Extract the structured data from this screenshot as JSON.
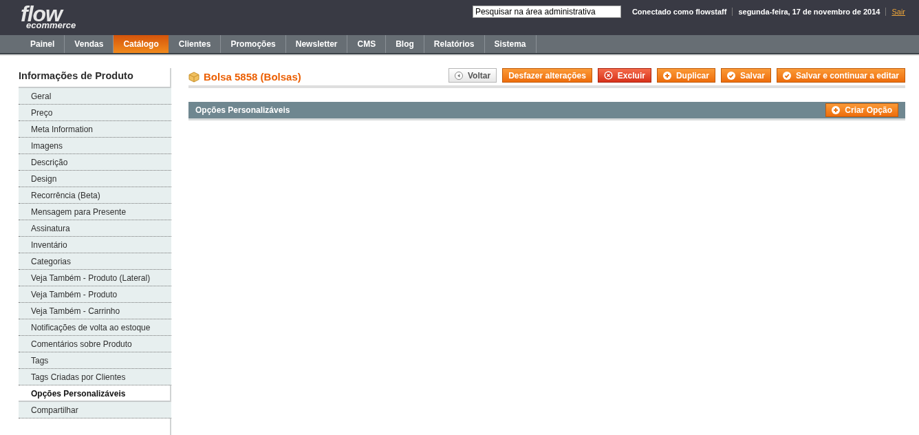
{
  "logo": {
    "title": "flow",
    "subtitle": "ecommerce"
  },
  "header": {
    "search": {
      "placeholder": "Pesquisar na área administrativa"
    },
    "user": "Conectado como flowstaff",
    "date": "segunda-feira, 17 de novembro de 2014",
    "logout": "Sair"
  },
  "nav": [
    {
      "label": "Painel",
      "selected": false
    },
    {
      "label": "Vendas",
      "selected": false
    },
    {
      "label": "Catálogo",
      "selected": true
    },
    {
      "label": "Clientes",
      "selected": false
    },
    {
      "label": "Promoções",
      "selected": false
    },
    {
      "label": "Newsletter",
      "selected": false
    },
    {
      "label": "CMS",
      "selected": false
    },
    {
      "label": "Blog",
      "selected": false
    },
    {
      "label": "Relatórios",
      "selected": false
    },
    {
      "label": "Sistema",
      "selected": false
    }
  ],
  "sidebar": {
    "title": "Informações de Produto",
    "items": [
      {
        "label": "Geral",
        "selected": false
      },
      {
        "label": "Preço",
        "selected": false
      },
      {
        "label": "Meta Information",
        "selected": false
      },
      {
        "label": "Imagens",
        "selected": false
      },
      {
        "label": "Descrição",
        "selected": false
      },
      {
        "label": "Design",
        "selected": false
      },
      {
        "label": "Recorrência (Beta)",
        "selected": false
      },
      {
        "label": "Mensagem para Presente",
        "selected": false
      },
      {
        "label": "Assinatura",
        "selected": false
      },
      {
        "label": "Inventário",
        "selected": false
      },
      {
        "label": "Categorias",
        "selected": false
      },
      {
        "label": "Veja Também - Produto (Lateral)",
        "selected": false
      },
      {
        "label": "Veja Também - Produto",
        "selected": false
      },
      {
        "label": "Veja Também - Carrinho",
        "selected": false
      },
      {
        "label": "Notificações de volta ao estoque",
        "selected": false
      },
      {
        "label": "Comentários sobre Produto",
        "selected": false
      },
      {
        "label": "Tags",
        "selected": false
      },
      {
        "label": "Tags Criadas por Clientes",
        "selected": false
      },
      {
        "label": "Opções Personalizáveis",
        "selected": true
      },
      {
        "label": "Compartilhar",
        "selected": false
      }
    ]
  },
  "page": {
    "title": "Bolsa 5858 (Bolsas)",
    "buttons": [
      {
        "label": "Voltar",
        "kind": "back"
      },
      {
        "label": "Desfazer alterações",
        "kind": "plain"
      },
      {
        "label": "Excluir",
        "kind": "delete"
      },
      {
        "label": "Duplicar",
        "kind": "add"
      },
      {
        "label": "Salvar",
        "kind": "save"
      },
      {
        "label": "Salvar e continuar a editar",
        "kind": "save"
      }
    ]
  },
  "section": {
    "title": "Opções Personalizáveis",
    "button": {
      "label": "Criar Opção",
      "kind": "add"
    }
  }
}
